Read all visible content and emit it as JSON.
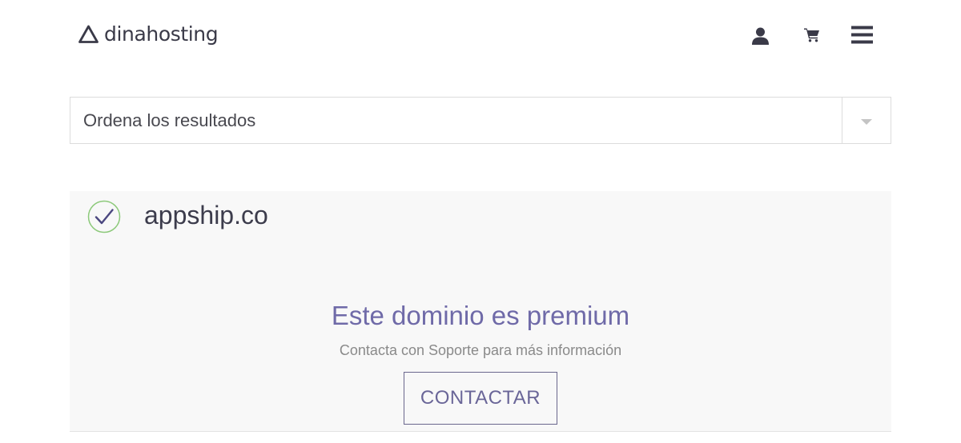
{
  "header": {
    "logo_text": "dinahosting",
    "icons": [
      "user-icon",
      "cart-icon",
      "menu-icon"
    ]
  },
  "sort": {
    "label": "Ordena los resultados"
  },
  "result": {
    "domain": "appship.co",
    "status_icon": "check-circle-icon",
    "premium_title": "Este dominio es premium",
    "premium_subtitle": "Contacta con Soporte para más información",
    "contact_label": "CONTACTAR"
  },
  "colors": {
    "accent": "#6f6aa8",
    "check": "#8cc97a",
    "text": "#3d3d4e",
    "card_bg": "#f8f8f8"
  }
}
